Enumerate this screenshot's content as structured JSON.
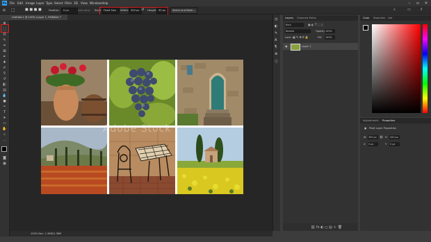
{
  "menubar": {
    "app_logo": "Ps",
    "items": [
      "File",
      "Edit",
      "Image",
      "Layer",
      "Type",
      "Select",
      "Filter",
      "3D",
      "View",
      "Window",
      "Help"
    ]
  },
  "options_bar": {
    "feather_label": "Feather:",
    "feather_value": "0 px",
    "antialias_label": "Anti-alias",
    "style_label": "Style:",
    "style_value": "Fixed Size",
    "width_label": "Width:",
    "width_value": "300 px",
    "height_label": "Height:",
    "height_value": "90 px",
    "select_mask_label": "Select and Mask..."
  },
  "document": {
    "tab_title": "Untitled-1 @ 100% (Layer 1, RGB/8#) *",
    "status": "100%  Doc: 1.36M/1.36M",
    "watermark": "Adobe Stock"
  },
  "layers_panel": {
    "tabs": [
      "Layers",
      "Channels",
      "Paths"
    ],
    "kind_label": "Kind",
    "blend_mode": "Normal",
    "opacity_label": "Opacity:",
    "opacity_value": "100%",
    "lock_label": "Lock:",
    "fill_label": "Fill:",
    "fill_value": "100%",
    "layer_name": "Layer 1"
  },
  "color_panel": {
    "tabs": [
      "Color",
      "Swatches",
      "Libr"
    ]
  },
  "properties_panel": {
    "tabs": [
      "Adjustments",
      "Properties"
    ],
    "title": "Pixel Layer Properties",
    "w_label": "W",
    "w_value": "300 px",
    "h_label": "H",
    "h_value": "200 px",
    "x_label": "X",
    "x_value": "0 px",
    "y_label": "Y",
    "y_value": "0 px"
  },
  "colors": {
    "accent_red": "#e02020",
    "ps_blue": "#31a8ff"
  }
}
